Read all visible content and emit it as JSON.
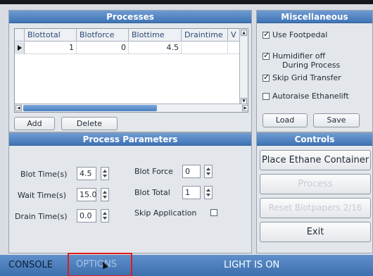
{
  "processes": {
    "title": "Processes",
    "columns": [
      "Blottotal",
      "Blotforce",
      "Blottime",
      "Draintime",
      "V"
    ],
    "rows": [
      [
        "1",
        "0",
        "4.5",
        "",
        ""
      ]
    ],
    "add_label": "Add",
    "delete_label": "Delete",
    "hscroll_label": "III"
  },
  "misc": {
    "title": "Miscellaneous",
    "options": [
      {
        "label": "Use Footpedal",
        "checked": true
      },
      {
        "label": "Humidifier off During Process",
        "line1": "Humidifier off",
        "line2": "During Process",
        "checked": true
      },
      {
        "label": "Skip Grid Transfer",
        "checked": true
      },
      {
        "label": "Autoraise Ethanelift",
        "checked": false
      }
    ],
    "load_label": "Load",
    "save_label": "Save"
  },
  "params": {
    "title": "Process Parameters",
    "blot_time_label": "Blot Time(s)",
    "blot_time_value": "4.5",
    "wait_time_label": "Wait Time(s)",
    "wait_time_value": "15.0",
    "drain_time_label": "Drain Time(s)",
    "drain_time_value": "0.0",
    "blot_force_label": "Blot Force",
    "blot_force_value": "0",
    "blot_total_label": "Blot Total",
    "blot_total_value": "1",
    "skip_application_label": "Skip Application",
    "skip_application_checked": false
  },
  "controls": {
    "title": "Controls",
    "place_label": "Place Ethane Container",
    "process_label": "Process",
    "reset_label": "Reset Blotpapers 2/16",
    "exit_label": "Exit"
  },
  "bottombar": {
    "console_label": "CONSOLE",
    "options_label": "OPTIONS",
    "status": "LIGHT IS ON"
  }
}
